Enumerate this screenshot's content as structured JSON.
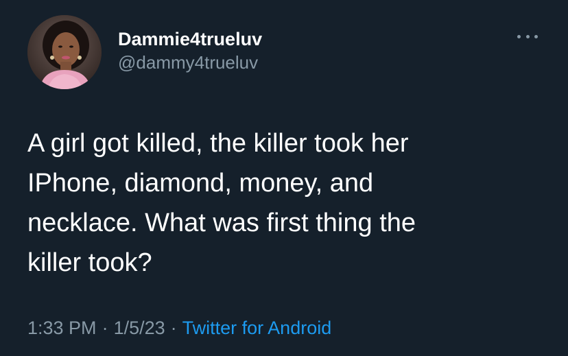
{
  "user": {
    "display_name": "Dammie4trueluv",
    "handle": "@dammy4trueluv"
  },
  "tweet": {
    "lines": [
      "A girl got killed, the killer took her",
      "IPhone, diamond, money, and",
      "necklace. What was first thing the",
      "killer took?"
    ],
    "time": "1:33 PM",
    "date": "1/5/23",
    "separator": "·",
    "source": "Twitter for Android"
  },
  "icons": {
    "more": "more-horizontal-icon",
    "avatar": "profile-photo"
  },
  "colors": {
    "background": "#15202b",
    "text_primary": "#ffffff",
    "text_secondary": "#8899a6",
    "link": "#1d9bf0"
  }
}
